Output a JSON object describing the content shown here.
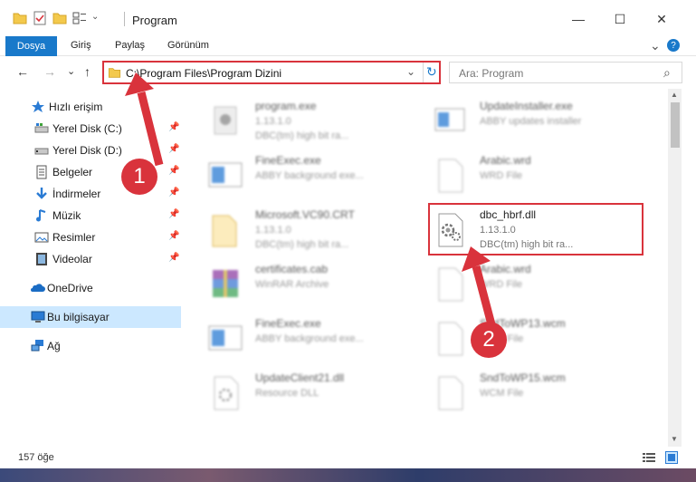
{
  "window": {
    "title": "Program",
    "minimize_glyph": "—",
    "maximize_glyph": "☐",
    "close_glyph": "✕"
  },
  "ribbon": {
    "tabs": [
      "Dosya",
      "Giriş",
      "Paylaş",
      "Görünüm"
    ],
    "collapse_glyph": "⌄",
    "help_glyph": "?"
  },
  "navigation": {
    "back_glyph": "←",
    "forward_glyph": "→",
    "dropdown_glyph": "⌄",
    "up_glyph": "↑",
    "address_path": "C:\\Program Files\\Program Dizini",
    "address_dropdown_glyph": "⌄",
    "refresh_glyph": "↻",
    "search_placeholder": "Ara: Program",
    "search_glyph": "⌕"
  },
  "sidebar": {
    "items": [
      {
        "label": "Hızlı erişim",
        "icon": "star-icon",
        "pinned": false
      },
      {
        "label": "Yerel Disk (C:)",
        "icon": "drive-icon",
        "pinned": true
      },
      {
        "label": "Yerel Disk (D:)",
        "icon": "drive-icon",
        "pinned": true
      },
      {
        "label": "Belgeler",
        "icon": "documents-icon",
        "pinned": true
      },
      {
        "label": "İndirmeler",
        "icon": "downloads-icon",
        "pinned": true
      },
      {
        "label": "Müzik",
        "icon": "music-icon",
        "pinned": true
      },
      {
        "label": "Resimler",
        "icon": "pictures-icon",
        "pinned": true
      },
      {
        "label": "Videolar",
        "icon": "videos-icon",
        "pinned": true
      },
      {
        "label": "OneDrive",
        "icon": "onedrive-icon",
        "pinned": false
      },
      {
        "label": "Bu bilgisayar",
        "icon": "computer-icon",
        "pinned": false,
        "selected": true
      },
      {
        "label": "Ağ",
        "icon": "network-icon",
        "pinned": false
      }
    ],
    "pin_glyph": "📌"
  },
  "files": [
    {
      "name": "program.exe",
      "line1": "1.13.1.0",
      "line2": "DBC(tm) high bit ra...",
      "icon": "exe-icon"
    },
    {
      "name": "UpdateInstaller.exe",
      "line1": "ABBY updates installer",
      "line2": "",
      "icon": "installer-icon"
    },
    {
      "name": "FineExec.exe",
      "line1": "ABBY background exe...",
      "line2": "",
      "icon": "window-exe-icon"
    },
    {
      "name": "Arabic.wrd",
      "line1": "WRD File",
      "line2": "",
      "icon": "blank-file-icon"
    },
    {
      "name": "Microsoft.VC90.CRT",
      "line1": "1.13.1.0",
      "line2": "DBC(tm) high bit ra...",
      "icon": "folder-file-icon"
    },
    {
      "name": "dbc_hbrf.dll",
      "line1": "1.13.1.0",
      "line2": "DBC(tm) high bit ra...",
      "icon": "dll-gear-icon"
    },
    {
      "name": "certificates.cab",
      "line1": "WinRAR Archive",
      "line2": "",
      "icon": "archive-icon"
    },
    {
      "name": "Arabic.wrd",
      "line1": "WRD File",
      "line2": "",
      "icon": "blank-file-icon"
    },
    {
      "name": "FineExec.exe",
      "line1": "ABBY background exe...",
      "line2": "",
      "icon": "window-exe-icon"
    },
    {
      "name": "SndToWP13.wcm",
      "line1": "WCM File",
      "line2": "",
      "icon": "blank-file-icon"
    },
    {
      "name": "UpdateClient21.dll",
      "line1": "Resource DLL",
      "line2": "",
      "icon": "dll-gear-icon"
    },
    {
      "name": "SndToWP15.wcm",
      "line1": "WCM File",
      "line2": "",
      "icon": "blank-file-icon"
    }
  ],
  "status": {
    "count": "157 öğe"
  },
  "annotations": {
    "badge1": "1",
    "badge2": "2",
    "accent": "#d9333c"
  }
}
